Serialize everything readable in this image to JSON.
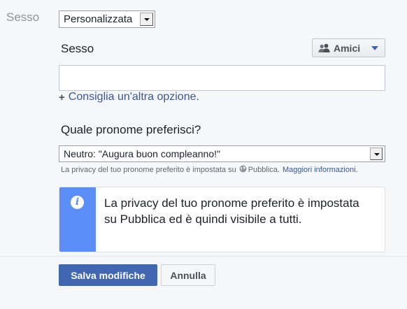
{
  "gender_row": {
    "label": "Sesso",
    "selected": "Personalizzata"
  },
  "custom_gender": {
    "label": "Sesso",
    "audience_label": "Amici",
    "input_value": "",
    "suggest_link": "Consiglia un'altra opzione."
  },
  "pronoun": {
    "question": "Quale pronome preferisci?",
    "selected": "Neutro: \"Augura buon compleanno!\"",
    "privacy_note_prefix": "La privacy del tuo pronome preferito è impostata su",
    "privacy_value": "Pubblica.",
    "more_info_link": "Maggiori informazioni."
  },
  "info_box": {
    "icon": "info-icon",
    "text": "La privacy del tuo pronome preferito è impostata su Pubblica ed è quindi visibile a tutti.",
    "accent_color": "#5b8ef7"
  },
  "actions": {
    "save_label": "Salva modifiche",
    "cancel_label": "Annulla"
  },
  "colors": {
    "primary": "#4267b2",
    "link": "#365899"
  }
}
